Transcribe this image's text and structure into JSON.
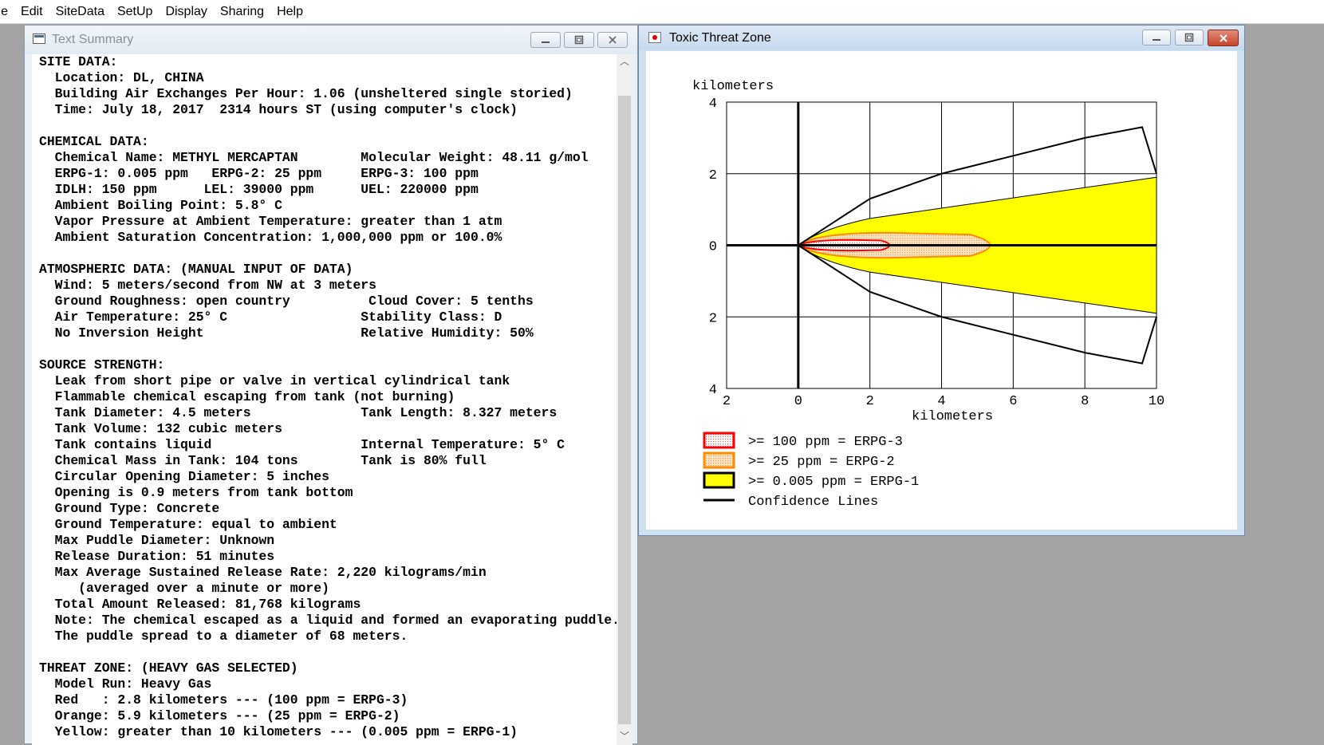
{
  "menubar": {
    "items": [
      "ile",
      "Edit",
      "SiteData",
      "SetUp",
      "Display",
      "Sharing",
      "Help"
    ]
  },
  "text_window": {
    "title": "Text Summary",
    "icon": "text-document-icon",
    "lines": [
      "SITE DATA:",
      "  Location: DL, CHINA",
      "  Building Air Exchanges Per Hour: 1.06 (unsheltered single storied)",
      "  Time: July 18, 2017  2314 hours ST (using computer's clock)",
      "",
      "CHEMICAL DATA:",
      "  Chemical Name: METHYL MERCAPTAN        Molecular Weight: 48.11 g/mol",
      "  ERPG-1: 0.005 ppm   ERPG-2: 25 ppm     ERPG-3: 100 ppm",
      "  IDLH: 150 ppm      LEL: 39000 ppm      UEL: 220000 ppm",
      "  Ambient Boiling Point: 5.8° C",
      "  Vapor Pressure at Ambient Temperature: greater than 1 atm",
      "  Ambient Saturation Concentration: 1,000,000 ppm or 100.0%",
      "",
      "ATMOSPHERIC DATA: (MANUAL INPUT OF DATA)",
      "  Wind: 5 meters/second from NW at 3 meters",
      "  Ground Roughness: open country          Cloud Cover: 5 tenths",
      "  Air Temperature: 25° C                 Stability Class: D",
      "  No Inversion Height                    Relative Humidity: 50%",
      "",
      "SOURCE STRENGTH:",
      "  Leak from short pipe or valve in vertical cylindrical tank",
      "  Flammable chemical escaping from tank (not burning)",
      "  Tank Diameter: 4.5 meters              Tank Length: 8.327 meters",
      "  Tank Volume: 132 cubic meters",
      "  Tank contains liquid                   Internal Temperature: 5° C",
      "  Chemical Mass in Tank: 104 tons        Tank is 80% full",
      "  Circular Opening Diameter: 5 inches",
      "  Opening is 0.9 meters from tank bottom",
      "  Ground Type: Concrete",
      "  Ground Temperature: equal to ambient",
      "  Max Puddle Diameter: Unknown",
      "  Release Duration: 51 minutes",
      "  Max Average Sustained Release Rate: 2,220 kilograms/min",
      "     (averaged over a minute or more)",
      "  Total Amount Released: 81,768 kilograms",
      "  Note: The chemical escaped as a liquid and formed an evaporating puddle.",
      "  The puddle spread to a diameter of 68 meters.",
      "",
      "THREAT ZONE: (HEAVY GAS SELECTED)",
      "  Model Run: Heavy Gas",
      "  Red   : 2.8 kilometers --- (100 ppm = ERPG-3)",
      "  Orange: 5.9 kilometers --- (25 ppm = ERPG-2)",
      "  Yellow: greater than 10 kilometers --- (0.005 ppm = ERPG-1)"
    ]
  },
  "map_window": {
    "title": "Toxic Threat Zone",
    "icon": "threat-zone-icon",
    "y_axis_title": "kilometers",
    "x_axis_title": "kilometers"
  },
  "chart_data": {
    "type": "area",
    "title": "",
    "xlabel": "kilometers",
    "ylabel": "kilometers",
    "xlim": [
      -2,
      10
    ],
    "ylim": [
      -4,
      4
    ],
    "x_ticks": [
      2,
      0,
      2,
      4,
      6,
      8,
      10
    ],
    "y_ticks": [
      4,
      2,
      0,
      2,
      4
    ],
    "grid": true,
    "zones": [
      {
        "name": ">= 100 ppm = ERPG-3",
        "color": "#ff0000",
        "fill": "#f6c9c9",
        "max_distance_km": 2.8,
        "half_width_km": 0.15
      },
      {
        "name": ">= 25 ppm = ERPG-2",
        "color": "#ff8c00",
        "fill": "#fbd9b0",
        "max_distance_km": 5.9,
        "half_width_km": 0.35
      },
      {
        "name": ">= 0.005 ppm = ERPG-1",
        "color": "#000000",
        "fill": "#ffff00",
        "max_distance_km": 10,
        "half_width_km": 1.9
      }
    ],
    "confidence_lines": {
      "name": "Confidence Lines",
      "upper": [
        [
          0,
          0
        ],
        [
          2,
          1.3
        ],
        [
          4,
          2.0
        ],
        [
          6,
          2.5
        ],
        [
          8,
          3.0
        ],
        [
          9.6,
          3.3
        ],
        [
          10,
          2.0
        ]
      ],
      "lower": [
        [
          0,
          0
        ],
        [
          2,
          -1.3
        ],
        [
          4,
          -2.0
        ],
        [
          6,
          -2.5
        ],
        [
          8,
          -3.0
        ],
        [
          9.6,
          -3.3
        ],
        [
          10,
          -2.0
        ]
      ]
    },
    "legend": [
      {
        "label": ">= 100 ppm = ERPG-3",
        "swatch": "red-dotted"
      },
      {
        "label": ">= 25 ppm = ERPG-2",
        "swatch": "orange-dotted"
      },
      {
        "label": ">= 0.005 ppm = ERPG-1",
        "swatch": "yellow"
      },
      {
        "label": "Confidence Lines",
        "swatch": "line"
      }
    ],
    "legend_position": "bottom-left"
  }
}
